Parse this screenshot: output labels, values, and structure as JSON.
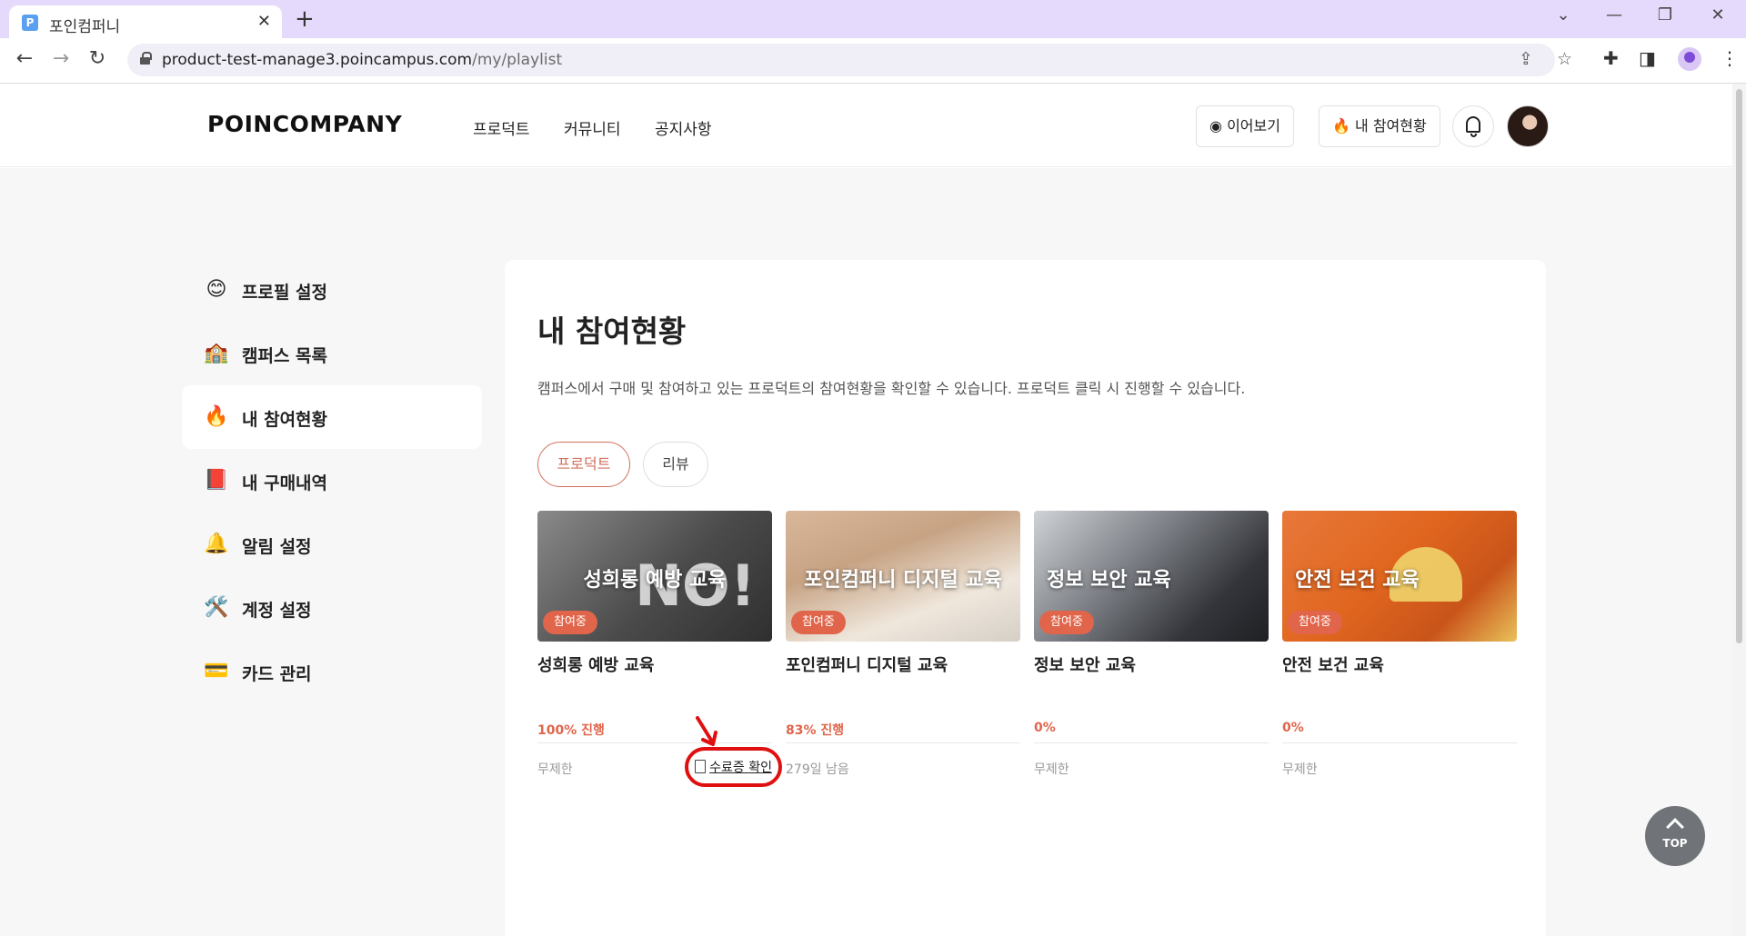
{
  "browser": {
    "tab_title": "포인컴퍼니",
    "tab_favicon": "P",
    "url_host": "product-test-manage3.poincampus.com",
    "url_path": "/my/playlist"
  },
  "header": {
    "logo": "POINCOMPANY",
    "nav": [
      "프로덕트",
      "커뮤니티",
      "공지사항"
    ],
    "continue_label": "이어보기",
    "participation_label": "내 참여현황"
  },
  "sidebar": {
    "items": [
      {
        "emoji": "😊",
        "label": "프로필 설정"
      },
      {
        "emoji": "🏫",
        "label": "캠퍼스 목록"
      },
      {
        "emoji": "🔥",
        "label": "내 참여현황"
      },
      {
        "emoji": "📕",
        "label": "내 구매내역"
      },
      {
        "emoji": "🔔",
        "label": "알림 설정"
      },
      {
        "emoji": "🛠️",
        "label": "계정 설정"
      },
      {
        "emoji": "💳",
        "label": "카드 관리"
      }
    ]
  },
  "main": {
    "title": "내 참여현황",
    "description": "캠퍼스에서 구매 및 참여하고 있는 프로덕트의 참여현황을 확인할 수 있습니다. 프로덕트 클릭 시 진행할 수 있습니다.",
    "tabs": [
      "프로덕트",
      "리뷰"
    ],
    "cards": [
      {
        "thumb_title": "성희롱 예방 교육",
        "badge": "참여중",
        "title": "성희롱 예방 교육",
        "progress": "100% 진행",
        "period": "무제한",
        "cert": "수료증 확인"
      },
      {
        "thumb_title": "포인컴퍼니 디지털 교육",
        "badge": "참여중",
        "title": "포인컴퍼니 디지털 교육",
        "progress": "83% 진행",
        "period": "279일 남음"
      },
      {
        "thumb_title": "정보 보안 교육",
        "badge": "참여중",
        "title": "정보 보안 교육",
        "progress": "0%",
        "period": "무제한"
      },
      {
        "thumb_title": "안전 보건 교육",
        "badge": "참여중",
        "title": "안전 보건 교육",
        "progress": "0%",
        "period": "무제한"
      }
    ]
  },
  "top_button": "TOP",
  "colors": {
    "accent": "#e0654b",
    "tab_strip": "#e6dafc",
    "active_pill": "#d2705e"
  }
}
